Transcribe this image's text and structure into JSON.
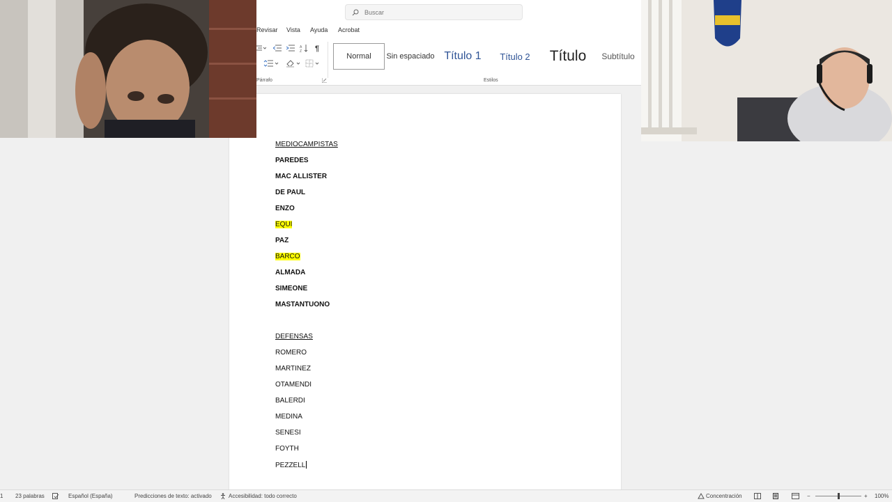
{
  "search": {
    "placeholder": "Buscar"
  },
  "menu": [
    "Revisar",
    "Vista",
    "Ayuda",
    "Acrobat"
  ],
  "ribbon": {
    "paragraph_label": "Párrafo",
    "styles_label": "Estilos",
    "pilcrow": "¶",
    "styles": [
      "Normal",
      "Sin espaciado",
      "Título 1",
      "Título 2",
      "Título",
      "Subtítulo"
    ]
  },
  "document": {
    "mid_heading": "MEDIOCAMPISTAS",
    "mid_players": [
      "PAREDES",
      "MAC ALLISTER",
      "DE PAUL",
      "ENZO",
      "EQUI",
      "PAZ",
      "BARCO",
      "ALMADA",
      "SIMEONE",
      "MASTANTUONO"
    ],
    "def_heading": "DEFENSAS",
    "def_players": [
      "ROMERO",
      "MARTINEZ",
      "OTAMENDI",
      "BALERDI",
      "MEDINA",
      "SENESI",
      "FOYTH",
      "PEZZELL"
    ]
  },
  "status": {
    "page": "1",
    "words": "23 palabras",
    "language": "Español (España)",
    "predictions": "Predicciones de texto: activado",
    "accessibility": "Accesibilidad: todo correcto",
    "focus": "Concentración",
    "zoom": "100%"
  },
  "colors": {
    "highlight": "#ffff00",
    "page": "#ffffff",
    "background": "#f0f0f0"
  },
  "icons": [
    "search-icon",
    "pilcrow-icon",
    "accessibility-icon",
    "focus-icon",
    "spelling-icon"
  ]
}
